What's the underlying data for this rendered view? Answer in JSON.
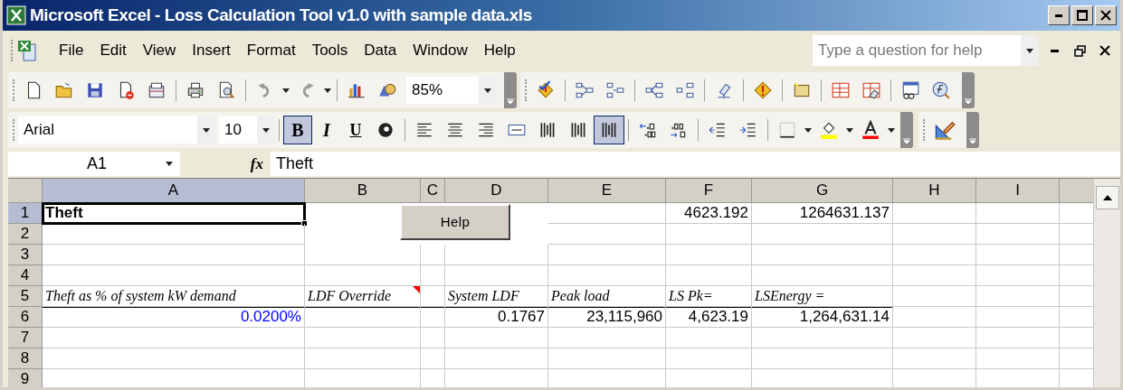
{
  "window": {
    "title": "Microsoft Excel - Loss Calculation Tool v1.0 with sample data.xls"
  },
  "menu": [
    {
      "label": "File"
    },
    {
      "label": "Edit"
    },
    {
      "label": "View"
    },
    {
      "label": "Insert"
    },
    {
      "label": "Format"
    },
    {
      "label": "Tools"
    },
    {
      "label": "Data"
    },
    {
      "label": "Window"
    },
    {
      "label": "Help"
    }
  ],
  "help_search": {
    "placeholder": "Type a question for help"
  },
  "standard_toolbar": [
    {
      "kind": "new"
    },
    {
      "kind": "open"
    },
    {
      "kind": "save"
    },
    {
      "kind": "permission"
    },
    {
      "kind": "email"
    },
    {
      "kind": "sep"
    },
    {
      "kind": "print"
    },
    {
      "kind": "preview"
    },
    {
      "kind": "sep"
    },
    {
      "kind": "undo"
    },
    {
      "kind": "drop"
    },
    {
      "kind": "redo"
    },
    {
      "kind": "drop"
    },
    {
      "kind": "sep"
    },
    {
      "kind": "chart"
    },
    {
      "kind": "drawing"
    }
  ],
  "zoom": {
    "value": "85%"
  },
  "auditing_toolbar": [
    {
      "kind": "errorcheck"
    },
    {
      "kind": "sep"
    },
    {
      "kind": "traceprec"
    },
    {
      "kind": "removeprec"
    },
    {
      "kind": "sep"
    },
    {
      "kind": "tracedep"
    },
    {
      "kind": "removedep"
    },
    {
      "kind": "sep"
    },
    {
      "kind": "eraser"
    },
    {
      "kind": "sep"
    },
    {
      "kind": "warning"
    },
    {
      "kind": "sep"
    },
    {
      "kind": "comment"
    },
    {
      "kind": "sep"
    },
    {
      "kind": "circle"
    },
    {
      "kind": "clearcircle"
    },
    {
      "kind": "sep"
    },
    {
      "kind": "watch"
    },
    {
      "kind": "evaluate"
    }
  ],
  "font": {
    "value": "Arial"
  },
  "font_size": {
    "value": "10"
  },
  "formatting_toolbar": [
    {
      "kind": "sep"
    },
    {
      "kind": "bold",
      "label": "B",
      "pressed": true
    },
    {
      "kind": "italic",
      "label": "I",
      "pressed": false
    },
    {
      "kind": "underline",
      "label": "U",
      "pressed": false
    },
    {
      "kind": "ball",
      "pressed": false
    },
    {
      "kind": "sep"
    },
    {
      "kind": "left",
      "pressed": false
    },
    {
      "kind": "center",
      "pressed": false
    },
    {
      "kind": "right",
      "pressed": false
    },
    {
      "kind": "merge",
      "pressed": false
    },
    {
      "kind": "bars",
      "pressed": false
    },
    {
      "kind": "bars",
      "pressed": false
    },
    {
      "kind": "bars",
      "pressed": true
    },
    {
      "kind": "sep"
    },
    {
      "kind": "incdec",
      "pressed": false
    },
    {
      "kind": "decdec",
      "pressed": false
    },
    {
      "kind": "sep"
    },
    {
      "kind": "outdent",
      "pressed": false
    },
    {
      "kind": "indent",
      "pressed": false
    },
    {
      "kind": "sep"
    },
    {
      "kind": "borders"
    },
    {
      "kind": "drop"
    },
    {
      "kind": "fill"
    },
    {
      "kind": "drop"
    },
    {
      "kind": "fontcolor"
    },
    {
      "kind": "drop"
    }
  ],
  "formula_bar": {
    "name_box": "A1",
    "function_label": "fx",
    "content": "Theft"
  },
  "sheet": {
    "columns": [
      {
        "label": "A",
        "selected": true
      },
      {
        "label": "B",
        "selected": false
      },
      {
        "label": "C",
        "selected": false
      },
      {
        "label": "D",
        "selected": false
      },
      {
        "label": "E",
        "selected": false
      },
      {
        "label": "F",
        "selected": false
      },
      {
        "label": "G",
        "selected": false
      },
      {
        "label": "H",
        "selected": false
      },
      {
        "label": "I",
        "selected": false
      }
    ],
    "rows": [
      {
        "label": "1",
        "selected": true,
        "top_border": false,
        "cells": [
          {
            "text": "Theft",
            "kind": "bold",
            "selected": true
          },
          {
            "kind": "empty"
          },
          {
            "kind": "empty"
          },
          {
            "kind": "empty"
          },
          {
            "kind": "empty"
          },
          {
            "text": "4623.192",
            "kind": "number",
            "selected": false
          },
          {
            "text": "1264631.137",
            "kind": "number",
            "selected": false
          }
        ]
      },
      {
        "label": "2",
        "selected": false,
        "top_border": false,
        "cells": []
      },
      {
        "label": "3",
        "selected": false,
        "top_border": false,
        "cells": []
      },
      {
        "label": "4",
        "selected": false,
        "top_border": false,
        "cells": []
      },
      {
        "label": "5",
        "selected": false,
        "top_border": false,
        "cells": [
          {
            "text": "Theft as % of system kW demand",
            "kind": "italic",
            "selected": false
          },
          {
            "text": "LDF Override",
            "kind": "italic",
            "selected": false,
            "comment": true
          },
          {
            "kind": "empty"
          },
          {
            "text": "System LDF",
            "kind": "italic",
            "selected": false
          },
          {
            "text": "Peak load",
            "kind": "italic",
            "selected": false
          },
          {
            "text": "LS Pk=",
            "kind": "italic",
            "selected": false
          },
          {
            "text": "LSEnergy =",
            "kind": "italic",
            "selected": false
          }
        ]
      },
      {
        "label": "6",
        "selected": false,
        "top_border": true,
        "cells": [
          {
            "text": "0.0200%",
            "kind": "input",
            "selected": false
          },
          {
            "kind": "empty"
          },
          {
            "kind": "empty"
          },
          {
            "text": "0.1767",
            "kind": "number",
            "selected": false
          },
          {
            "text": "23,115,960",
            "kind": "number",
            "selected": false
          },
          {
            "text": "4,623.19",
            "kind": "number",
            "selected": false
          },
          {
            "text": "1,264,631.14",
            "kind": "number",
            "selected": false
          }
        ]
      },
      {
        "label": "7",
        "selected": false,
        "top_border": false,
        "cells": []
      },
      {
        "label": "8",
        "selected": false,
        "top_border": false,
        "cells": []
      },
      {
        "label": "9",
        "selected": false,
        "top_border": false,
        "cells": []
      }
    ],
    "help_button": {
      "label": "Help"
    }
  }
}
